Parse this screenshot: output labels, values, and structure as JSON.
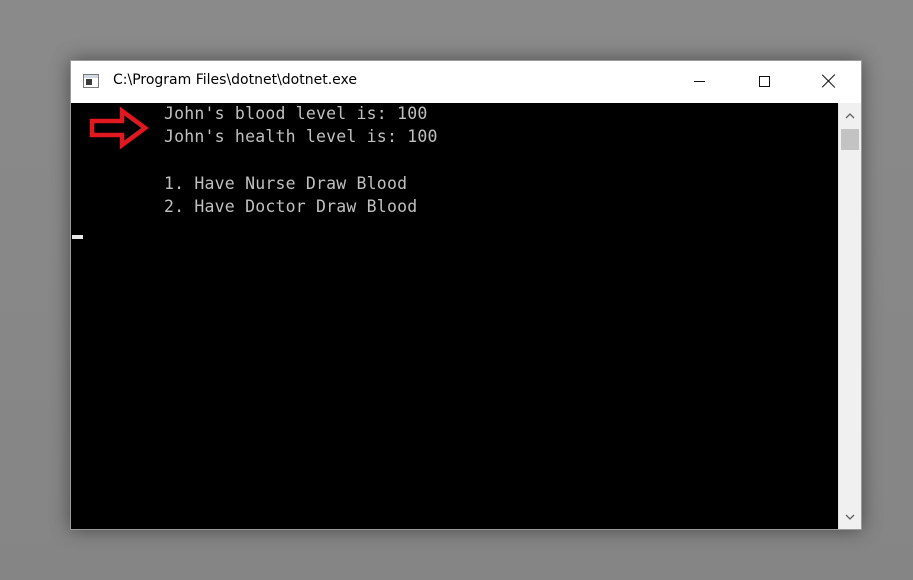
{
  "window": {
    "title": "C:\\Program Files\\dotnet\\dotnet.exe",
    "controls": {
      "minimize": "minimize-icon",
      "maximize": "maximize-icon",
      "close": "close-icon"
    }
  },
  "console": {
    "lines": [
      "John's blood level is: 100",
      "John's health level is: 100",
      "1. Have Nurse Draw Blood",
      "2. Have Doctor Draw Blood"
    ],
    "text_color": "#c0c0c0",
    "background": "#000000"
  },
  "annotation": {
    "icon": "arrow-right-icon",
    "color": "#e0181f"
  },
  "scrollbar": {
    "up": "chevron-up-icon",
    "down": "chevron-down-icon"
  }
}
